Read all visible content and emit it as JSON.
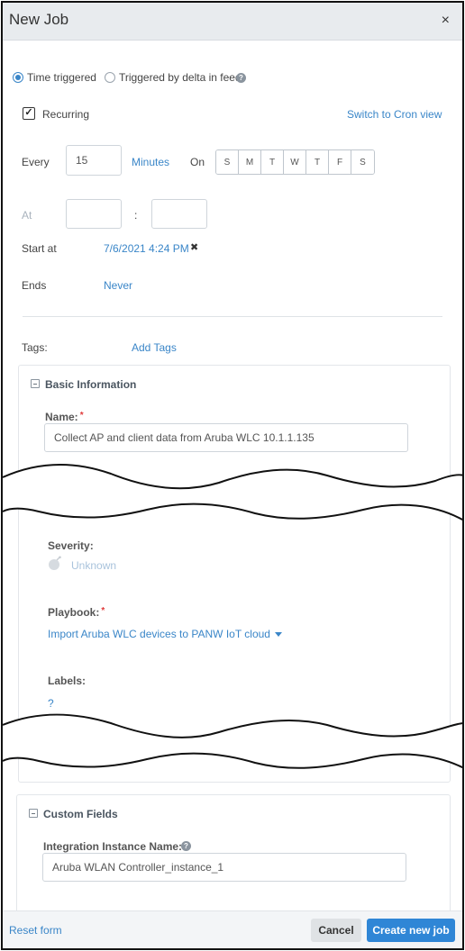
{
  "dialog": {
    "title": "New Job",
    "close_symbol": "×"
  },
  "trigger": {
    "time_label": "Time triggered",
    "delta_label": "Triggered by delta in feed",
    "selected": "time"
  },
  "recurring": {
    "label": "Recurring",
    "checked": true,
    "cron_link": "Switch to Cron view"
  },
  "schedule": {
    "every_label": "Every",
    "every_value": "15",
    "unit": "Minutes",
    "on_label": "On",
    "days": [
      "S",
      "M",
      "T",
      "W",
      "T",
      "F",
      "S"
    ],
    "at_label": "At",
    "colon": ":",
    "start_label": "Start at",
    "start_value": "7/6/2021 4:24 PM",
    "clear_symbol": "✖",
    "ends_label": "Ends",
    "ends_value": "Never"
  },
  "tags": {
    "label": "Tags:",
    "add_label": "Add Tags"
  },
  "basic": {
    "title": "Basic Information",
    "name_label": "Name:",
    "required_mark": "*",
    "name_value": "Collect AP and client data from Aruba WLC 10.1.1.135",
    "severity_label": "Severity:",
    "severity_value": "Unknown",
    "playbook_label": "Playbook:",
    "playbook_value": "Import Aruba WLC devices to PANW IoT cloud",
    "labels_label": "Labels:",
    "labels_value": "?"
  },
  "custom": {
    "title": "Custom Fields",
    "instance_label": "Integration Instance Name:",
    "instance_value": "Aruba WLAN Controller_instance_1"
  },
  "footer": {
    "reset_label": "Reset form",
    "cancel_label": "Cancel",
    "create_label": "Create new job"
  },
  "colors": {
    "accent": "#3a86c8",
    "primary_button": "#2f86d6",
    "required": "#e03a3a",
    "header_bg": "#e8ebee"
  }
}
